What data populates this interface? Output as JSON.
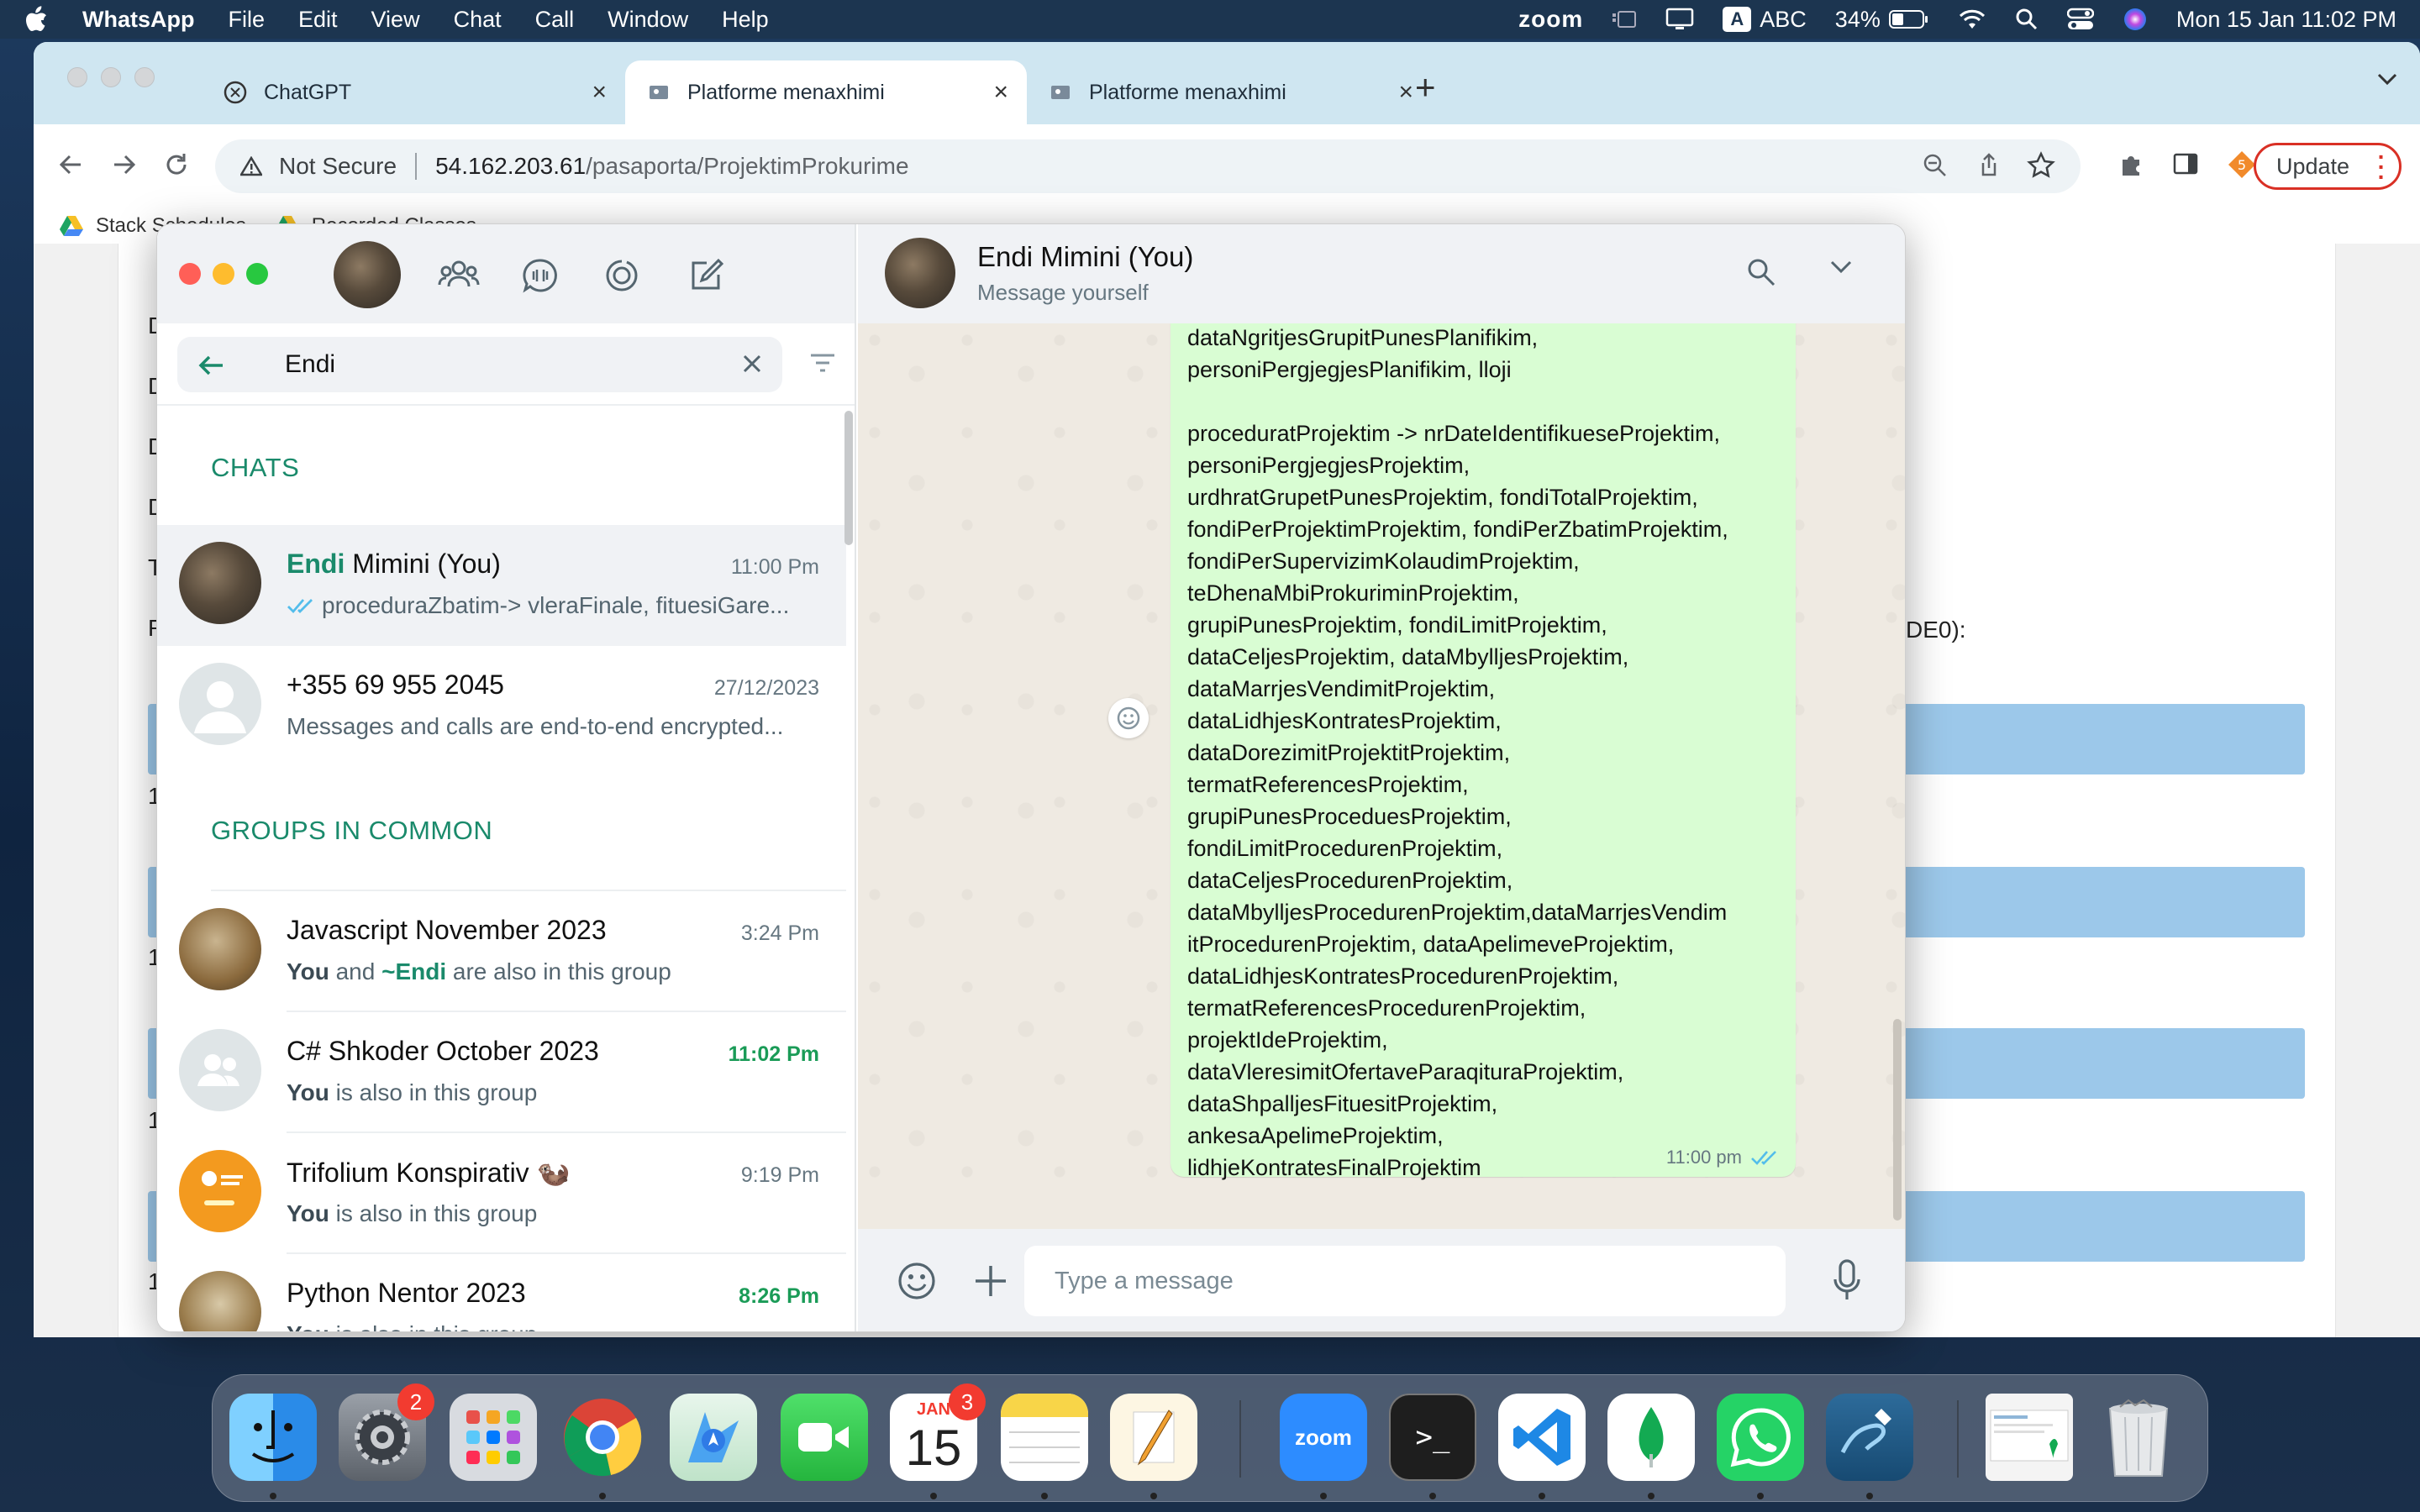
{
  "menubar": {
    "app_name": "WhatsApp",
    "menus": [
      "File",
      "Edit",
      "View",
      "Chat",
      "Call",
      "Window",
      "Help"
    ],
    "zoom": "zoom",
    "keyboard_badge": "A",
    "keyboard_label": "ABC",
    "battery": "34%",
    "datetime": "Mon 15 Jan  11:02 PM"
  },
  "browser": {
    "tabs": [
      {
        "title": "ChatGPT",
        "active": false
      },
      {
        "title": "Platforme menaxhimi",
        "active": true
      },
      {
        "title": "Platforme menaxhimi",
        "active": false
      }
    ],
    "security": "Not Secure",
    "url_host": "54.162.203.61",
    "url_path": "/pasaporta/ProjektimProkurime",
    "update_label": "Update",
    "bookmarks": [
      "Stack Schedules",
      "Recorded Classes"
    ]
  },
  "page": {
    "fragment_right": "DE0):",
    "left_markers": [
      "D",
      "D",
      "D",
      "D",
      "T",
      "R",
      "1",
      "1",
      "1",
      "1"
    ]
  },
  "whatsapp": {
    "search_value": "Endi",
    "sections": {
      "chats": "CHATS",
      "groups": "GROUPS IN COMMON"
    },
    "chats": [
      {
        "name_hl": "Endi",
        "name_rest": " Mimini (You)",
        "time": "11:00 Pm",
        "preview": "proceduraZbatim-> vleraFinale, fituesiGare..."
      },
      {
        "name": "+355 69 955 2045",
        "time": "27/12/2023",
        "preview": "Messages and calls are end-to-end encrypted..."
      }
    ],
    "groups": [
      {
        "name": "Javascript November 2023",
        "time": "3:24 Pm",
        "sub_you": "You",
        "sub_mid": " and ",
        "sub_endi": "~Endi",
        "sub_end": " are also in this group"
      },
      {
        "name": "C# Shkoder October 2023",
        "time": "11:02 Pm",
        "sub_you": "You",
        "sub_end": " is also in this group"
      },
      {
        "name": "Trifolium Konspirativ 🦦",
        "time": "9:19 Pm",
        "sub_you": "You",
        "sub_end": " is also in this group"
      },
      {
        "name": "Python Nentor 2023",
        "time": "8:26 Pm",
        "sub_you": "You",
        "sub_end": " is also in this group"
      }
    ],
    "chat_header": {
      "title": "Endi Mimini (You)",
      "subtitle": "Message yourself"
    },
    "message": {
      "text": "dataNgritjesGrupitPunesPlanifikim,\npersoniPergjegjesPlanifikim, lloji\n\nproceduratProjektim -> nrDateIdentifikueseProjektim,\npersoniPergjegjesProjektim,\nurdhratGrupetPunesProjektim, fondiTotalProjektim,\nfondiPerProjektimProjektim, fondiPerZbatimProjektim,\nfondiPerSupervizimKolaudimProjektim,\nteDhenaMbiProkuriminProjektim,\ngrupiPunesProjektim, fondiLimitProjektim,\ndataCeljesProjektim, dataMbylljesProjektim,\ndataMarrjesVendimitProjektim,\ndataLidhjesKontratesProjektim,\ndataDorezimitProjektitProjektim,\ntermatReferencesProjektim,\ngrupiPunesProceduesProjektim,\nfondiLimitProcedurenProjektim,\ndataCeljesProcedurenProjektim,\ndataMbylljesProcedurenProjektim,dataMarrjesVendim\nitProcedurenProjektim, dataApelimeveProjektim,\ndataLidhjesKontratesProcedurenProjektim,\ntermatReferencesProcedurenProjektim,\nprojektIdeProjektim,\ndataVleresimitOfertaveParaqituraProjektim,\ndataShpalljesFituesitProjektim,\nankesaApelimeProjektim,\nlidhjeKontratesFinalProjektim",
      "time": "11:00 pm"
    },
    "composer_placeholder": "Type a message"
  },
  "dock": {
    "badges": {
      "settings": "2",
      "calendar": "3"
    },
    "calendar_month": "JAN",
    "calendar_day": "15",
    "zoom_label": "zoom",
    "terminal_prompt": ">_"
  },
  "colors": {
    "wa_green": "#1a8a6b",
    "bubble": "#d9fdd3",
    "unread": "#1a9b57",
    "tab_strip": "#cfe6f1"
  }
}
